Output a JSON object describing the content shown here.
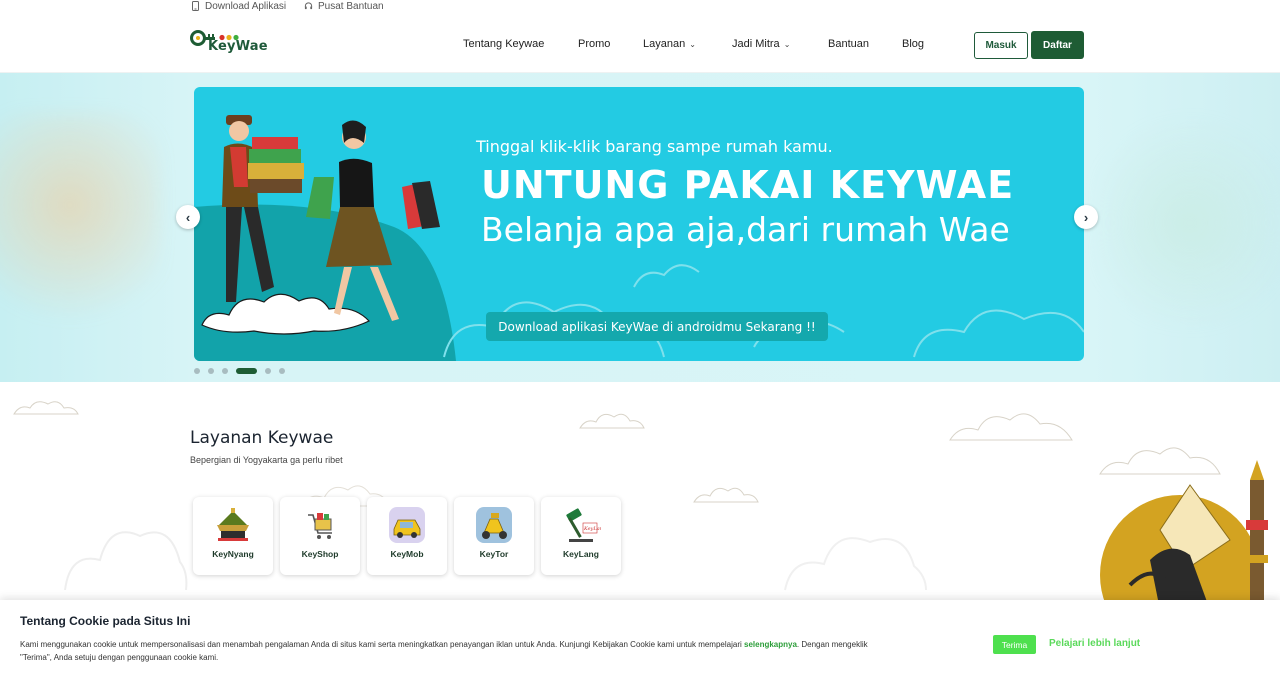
{
  "topbar": {
    "download_label": "Download Aplikasi",
    "help_label": "Pusat Bantuan",
    "download_icon": "phone-icon",
    "help_icon": "headset-icon"
  },
  "header": {
    "logo_text": "KeyWae",
    "nav": {
      "about": "Tentang Keywae",
      "promo": "Promo",
      "services": "Layanan",
      "partner": "Jadi Mitra",
      "help": "Bantuan",
      "blog": "Blog"
    },
    "login_label": "Masuk",
    "register_label": "Daftar"
  },
  "hero": {
    "tagline": "Tinggal klik-klik barang sampe rumah kamu.",
    "headline": "UNTUNG PAKAI KEYWAE",
    "subheadline": "Belanja apa aja,dari rumah Wae",
    "cta": "Download aplikasi KeyWae di androidmu Sekarang !!",
    "slide_count": 6,
    "active_slide": 4
  },
  "services": {
    "title": "Layanan Keywae",
    "subtitle": "Bepergian di Yogyakarta ga perlu ribet",
    "items": [
      {
        "label": "KeyNyang",
        "icon": "market-icon"
      },
      {
        "label": "KeyShop",
        "icon": "shopping-cart-icon"
      },
      {
        "label": "KeyMob",
        "icon": "car-icon"
      },
      {
        "label": "KeyTor",
        "icon": "scooter-icon"
      },
      {
        "label": "KeyLang",
        "icon": "auction-hammer-icon"
      }
    ]
  },
  "cookie": {
    "title": "Tentang Cookie pada Situs Ini",
    "text_before": "Kami menggunakan cookie untuk mempersonalisasi dan menambah pengalaman Anda di situs kami serta meningkatkan penayangan iklan untuk Anda. Kunjungi Kebijakan Cookie kami untuk mempelajari ",
    "link": "selengkapnya",
    "text_after": ". Dengan mengeklik \"Terima\", Anda setuju dengan penggunaan cookie kami.",
    "accept_label": "Terima",
    "more_label": "Pelajari lebih lanjut"
  },
  "colors": {
    "brand_green": "#1e5c34",
    "hero_cyan": "#23cbe3",
    "cookie_green": "#4ee04e"
  }
}
